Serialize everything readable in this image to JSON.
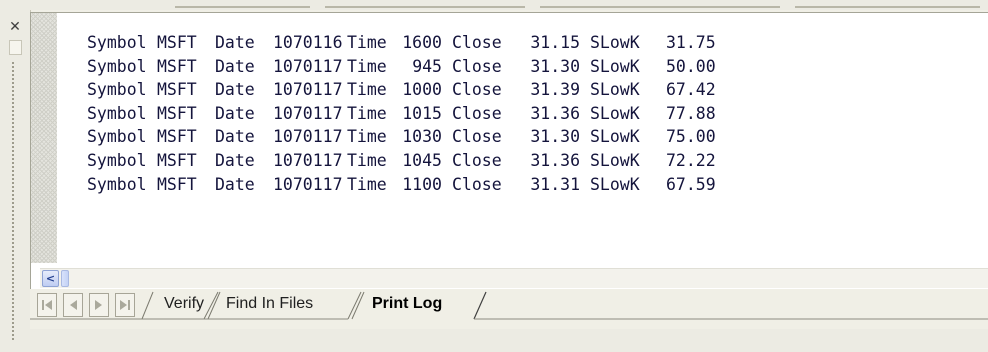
{
  "panel": {
    "close_icon": "close-icon",
    "log_lines": [
      {
        "symbol_label": "Symbol",
        "symbol": "MSFT",
        "date_label": "Date",
        "date": "1070116",
        "time_label": "Time",
        "time": "1600",
        "close_label": "Close",
        "close": "31.15",
        "slowk_label": "SLowK",
        "slowk": "31.75"
      },
      {
        "symbol_label": "Symbol",
        "symbol": "MSFT",
        "date_label": "Date",
        "date": "1070117",
        "time_label": "Time",
        "time": "945",
        "close_label": "Close",
        "close": "31.30",
        "slowk_label": "SLowK",
        "slowk": "50.00"
      },
      {
        "symbol_label": "Symbol",
        "symbol": "MSFT",
        "date_label": "Date",
        "date": "1070117",
        "time_label": "Time",
        "time": "1000",
        "close_label": "Close",
        "close": "31.39",
        "slowk_label": "SLowK",
        "slowk": "67.42"
      },
      {
        "symbol_label": "Symbol",
        "symbol": "MSFT",
        "date_label": "Date",
        "date": "1070117",
        "time_label": "Time",
        "time": "1015",
        "close_label": "Close",
        "close": "31.36",
        "slowk_label": "SLowK",
        "slowk": "77.88"
      },
      {
        "symbol_label": "Symbol",
        "symbol": "MSFT",
        "date_label": "Date",
        "date": "1070117",
        "time_label": "Time",
        "time": "1030",
        "close_label": "Close",
        "close": "31.30",
        "slowk_label": "SLowK",
        "slowk": "75.00"
      },
      {
        "symbol_label": "Symbol",
        "symbol": "MSFT",
        "date_label": "Date",
        "date": "1070117",
        "time_label": "Time",
        "time": "1045",
        "close_label": "Close",
        "close": "31.36",
        "slowk_label": "SLowK",
        "slowk": "72.22"
      },
      {
        "symbol_label": "Symbol",
        "symbol": "MSFT",
        "date_label": "Date",
        "date": "1070117",
        "time_label": "Time",
        "time": "1100",
        "close_label": "Close",
        "close": "31.31",
        "slowk_label": "SLowK",
        "slowk": "67.59"
      }
    ]
  },
  "tabs": [
    {
      "label": "Verify",
      "active": false
    },
    {
      "label": "Find In Files",
      "active": false
    },
    {
      "label": "Print Log",
      "active": true
    }
  ],
  "colors": {
    "text": "#14143c",
    "chrome": "#f0efe6",
    "scroll_accent": "#24408f"
  }
}
